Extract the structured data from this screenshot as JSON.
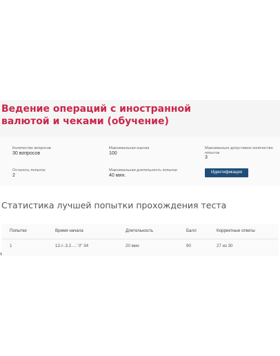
{
  "course": {
    "title": "Ведение операций с иностранной валютой и чеками (обучение)"
  },
  "info": {
    "questions_label": "Количество вопросов",
    "questions_value": "30 вопросов",
    "max_score_label": "Максимальная оценка",
    "max_score_value": "100",
    "max_attempts_label": "Максимально допустимое количество попыток",
    "max_attempts_value": "3",
    "attempts_left_label": "Осталось попыток",
    "attempts_left_value": "2",
    "max_duration_label": "Максимальная длительность попытки",
    "max_duration_value": "40 мин."
  },
  "actions": {
    "identify_label": "Идентификация"
  },
  "stats": {
    "title": "Статистика лучшей попытки прохождения теста",
    "columns": [
      "Попытки",
      "Время начала",
      "Длительность",
      "Балл",
      "Корректные ответы"
    ],
    "rows": [
      [
        "1",
        "12-/-.3.2….’ 0\" 34",
        "20 мин",
        "90",
        "27 из 30"
      ]
    ]
  },
  "colors": {
    "title": "#c8274b",
    "button": "#1f4e79"
  }
}
